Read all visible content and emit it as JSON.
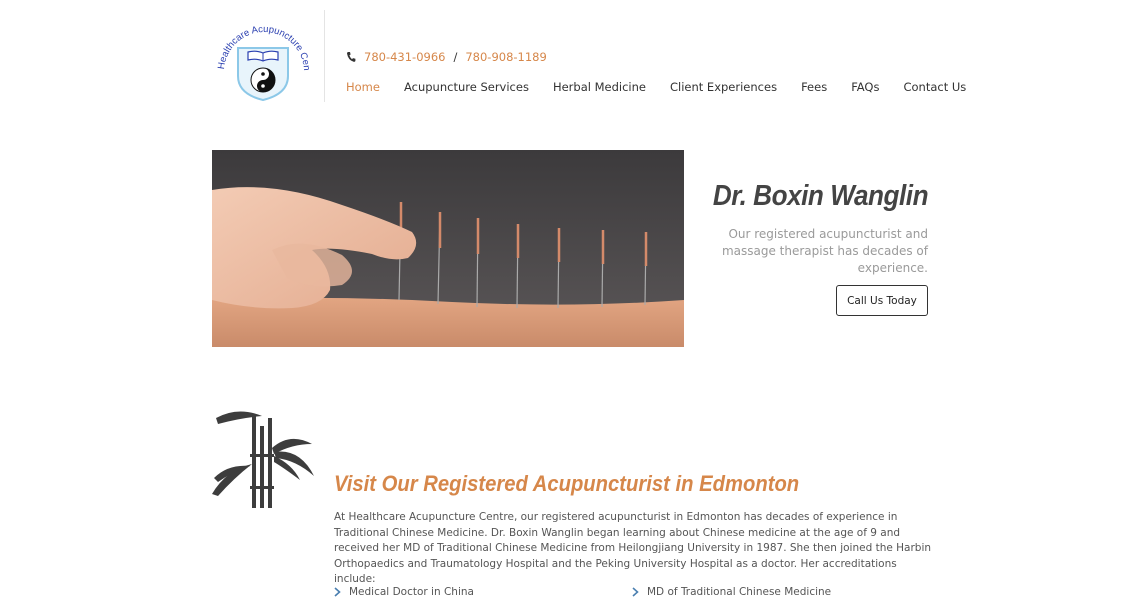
{
  "logo": {
    "arc_text": "Healthcare Acupuncture Centre"
  },
  "header": {
    "phone1": "780-431-0966",
    "separator": "/",
    "phone2": "780-908-1189",
    "nav": [
      {
        "label": "Home"
      },
      {
        "label": "Acupuncture Services"
      },
      {
        "label": "Herbal Medicine"
      },
      {
        "label": "Client Experiences"
      },
      {
        "label": "Fees"
      },
      {
        "label": "FAQs"
      },
      {
        "label": "Contact Us"
      }
    ]
  },
  "hero": {
    "title": "Dr. Boxin Wanglin",
    "subtitle": "Our registered acupuncturist and massage therapist has decades of experience.",
    "cta": "Call Us Today"
  },
  "about": {
    "title": "Visit Our Registered Acupuncturist in Edmonton",
    "body": "At Healthcare Acupuncture Centre, our registered acupuncturist in Edmonton has decades of experience in Traditional Chinese Medicine. Dr. Boxin Wanglin began learning about Chinese medicine at the age of 9 and received her MD of Traditional Chinese Medicine from Heilongjiang University in 1987. She then joined the Harbin Orthopaedics and Traumatology Hospital and the Peking University Hospital as a doctor. Her accreditations include:",
    "accreditations": [
      {
        "label": "Medical Doctor in China"
      },
      {
        "label": "MD of Traditional Chinese Medicine"
      }
    ]
  },
  "colors": {
    "accent": "#d6874a",
    "text": "#444444"
  }
}
